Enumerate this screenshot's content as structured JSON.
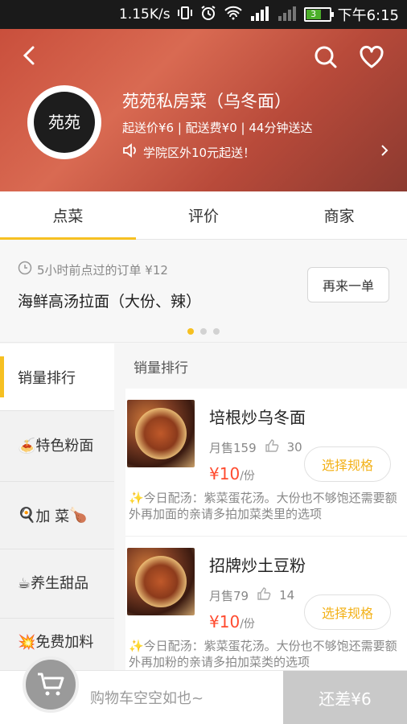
{
  "status_bar": {
    "net_speed": "1.15K/s",
    "battery": "3",
    "time": "下午6:15"
  },
  "header": {
    "back_icon": "chevron-left-icon",
    "search_icon": "search-icon",
    "favorite_icon": "heart-icon",
    "logo_text": "苑苑",
    "shop_name": "苑苑私房菜（乌冬面）",
    "info": "起送价¥6 | 配送费¥0 | 44分钟送达",
    "notice": "学院区外10元起送！"
  },
  "tabs": [
    {
      "label": "点菜",
      "active": true
    },
    {
      "label": "评价",
      "active": false
    },
    {
      "label": "商家",
      "active": false
    }
  ],
  "recent_order": {
    "meta": "5小时前点过的订单   ¥12",
    "dish": "海鲜高汤拉面（大份、辣）",
    "reorder_label": "再来一单",
    "page_dots": 3,
    "active_dot": 0
  },
  "sidebar": {
    "items": [
      {
        "label": "销量排行",
        "prefix": "",
        "suffix": "",
        "active": true
      },
      {
        "label": "特色粉面",
        "prefix": "🍝",
        "suffix": "",
        "active": false
      },
      {
        "label": "加 菜",
        "prefix": "🍳",
        "suffix": "🍗",
        "active": false
      },
      {
        "label": "养生甜品",
        "prefix": "☕",
        "suffix": "",
        "active": false
      },
      {
        "label": "免费加料",
        "prefix": "💥",
        "suffix": "",
        "active": false
      }
    ]
  },
  "menu": {
    "section_title": "销量排行",
    "items": [
      {
        "name": "培根炒乌冬面",
        "monthly_sales": "月售159",
        "likes": "30",
        "price": "¥10",
        "unit": "/份",
        "spec_label": "选择规格",
        "note": "✨今日配汤：紫菜蛋花汤。大份也不够饱还需要额外再加面的亲请多拍加菜类里的选项"
      },
      {
        "name": "招牌炒土豆粉",
        "monthly_sales": "月售79",
        "likes": "14",
        "price": "¥10",
        "unit": "/份",
        "spec_label": "选择规格",
        "note": "✨今日配汤：紫菜蛋花汤。大份也不够饱还需要额外再加粉的亲请多拍加菜类的选项"
      }
    ]
  },
  "cart": {
    "icon": "cart-icon",
    "empty_text": "购物车空空如也~",
    "checkout_label": "还差¥6"
  },
  "colors": {
    "accent": "#f6c021",
    "price": "#ff4b2f",
    "spec_text": "#f3b21a"
  }
}
